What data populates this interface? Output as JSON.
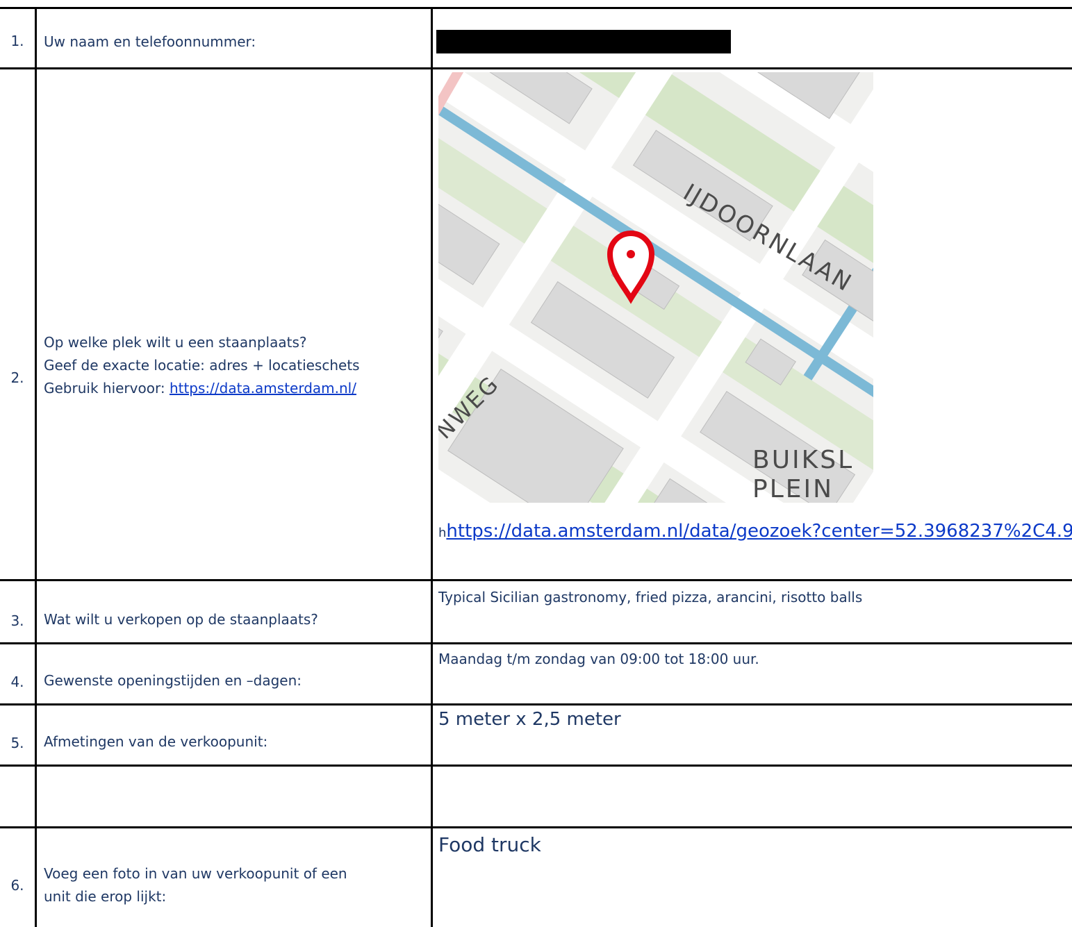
{
  "rows": [
    {
      "number": "1.",
      "question": "Uw naam en telefoonnummer:",
      "answer_redacted": true
    },
    {
      "number": "2.",
      "question_lines": [
        "Op welke plek wilt u een staanplaats?",
        "Geef de exacte locatie: adres + locatieschets",
        "Gebruik hiervoor: "
      ],
      "question_link": "https://data.amsterdam.nl/",
      "map": {
        "street_labels": [
          "IJDOORNLAAN",
          "NWEG",
          "BUIKSL",
          "PLEIN"
        ],
        "pin_icon": "map-pin-icon",
        "pin_color": "#e30613"
      },
      "answer_prefix": "h",
      "answer_link": "https://data.amsterdam.nl/data/geozoek?center=52.3968237%2C4.9"
    },
    {
      "number": "3.",
      "question": "Wat wilt u verkopen op de staanplaats?",
      "answer": "Typical Sicilian gastronomy, fried pizza, arancini, risotto balls"
    },
    {
      "number": "4.",
      "question": "Gewenste openingstijden en –dagen:",
      "answer": "Maandag t/m zondag van 09:00 tot 18:00 uur."
    },
    {
      "number": "5.",
      "question": "Afmetingen van de verkoopunit:",
      "answer": "5 meter x 2,5 meter"
    },
    {
      "number": "6.",
      "question_lines": [
        "Voeg een foto in van uw verkoopunit of een",
        "unit die erop lijkt:"
      ],
      "answer": "Food truck"
    }
  ],
  "colors": {
    "text": "#1f3864",
    "link": "#0b39c8",
    "border": "#000000"
  }
}
